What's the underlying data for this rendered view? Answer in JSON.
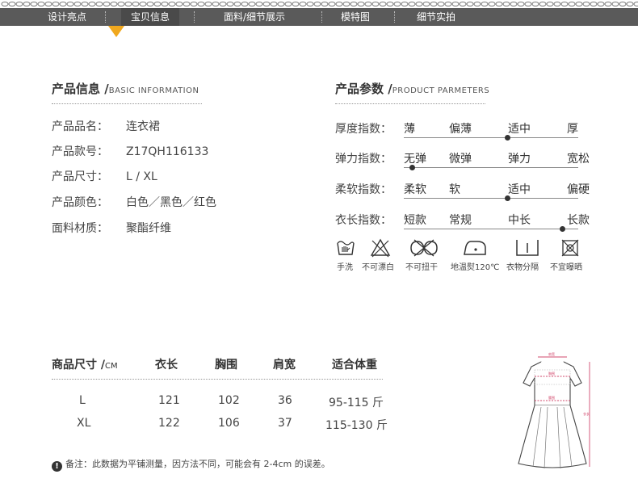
{
  "nav": {
    "items": [
      "设计亮点",
      "宝贝信息",
      "面料/细节展示",
      "模特图",
      "细节实拍"
    ],
    "active": "宝贝信息",
    "bg_color": "#5a5a5a",
    "marker_color": "#f0a81e"
  },
  "info": {
    "title": "产品信息",
    "title_en": "BASIC INFORMATION",
    "rows": [
      {
        "key": "产品品名：",
        "value": "连衣裙"
      },
      {
        "key": "产品款号：",
        "value": "Z17QH116133"
      },
      {
        "key": "产品尺寸：",
        "value": "L / XL"
      },
      {
        "key": "产品颜色：",
        "value": "白色／黑色／红色"
      },
      {
        "key": "面料材质：",
        "value": "聚酯纤维"
      }
    ]
  },
  "params": {
    "title": "产品参数",
    "title_en": "PRODUCT PARMETERS",
    "rows": [
      {
        "label": "厚度指数：",
        "options": [
          "薄",
          "偏薄",
          "适中",
          "厚"
        ],
        "selected": 2
      },
      {
        "label": "弹力指数：",
        "options": [
          "无弹",
          "微弹",
          "弹力",
          "宽松"
        ],
        "selected": 0
      },
      {
        "label": "柔软指数：",
        "options": [
          "柔软",
          "软",
          "适中",
          "偏硬"
        ],
        "selected": 2
      },
      {
        "label": "衣长指数：",
        "options": [
          "短款",
          "常规",
          "中长",
          "长款"
        ],
        "selected": 3
      }
    ],
    "care": [
      {
        "icon": "hand-wash-icon",
        "label": "手洗"
      },
      {
        "icon": "no-bleach-icon",
        "label": "不可漂白"
      },
      {
        "icon": "no-wring-icon",
        "label": "不可扭干"
      },
      {
        "icon": "low-iron-icon",
        "label": "地温熨120℃"
      },
      {
        "icon": "hang-dry-icon",
        "label": "衣物分隔"
      },
      {
        "icon": "no-sun-dry-icon",
        "label": "不宜曝晒"
      }
    ]
  },
  "size_table": {
    "headers": [
      "商品尺寸 /",
      "衣长",
      "胸围",
      "肩宽",
      "适合体重"
    ],
    "unit": "CM",
    "rows": [
      [
        "L",
        "121",
        "102",
        "36",
        "95-115 斤"
      ],
      [
        "XL",
        "122",
        "106",
        "37",
        "115-130 斤"
      ]
    ]
  },
  "note": {
    "icon": "exclamation-icon",
    "text": "备注：此数据为平铺测量，因方法不同，可能会有 2-4cm 的误差。"
  },
  "diagram": {
    "labels": [
      "肩宽",
      "胸围",
      "腰围",
      "衣长"
    ],
    "measure_color": "#d24a6e"
  }
}
